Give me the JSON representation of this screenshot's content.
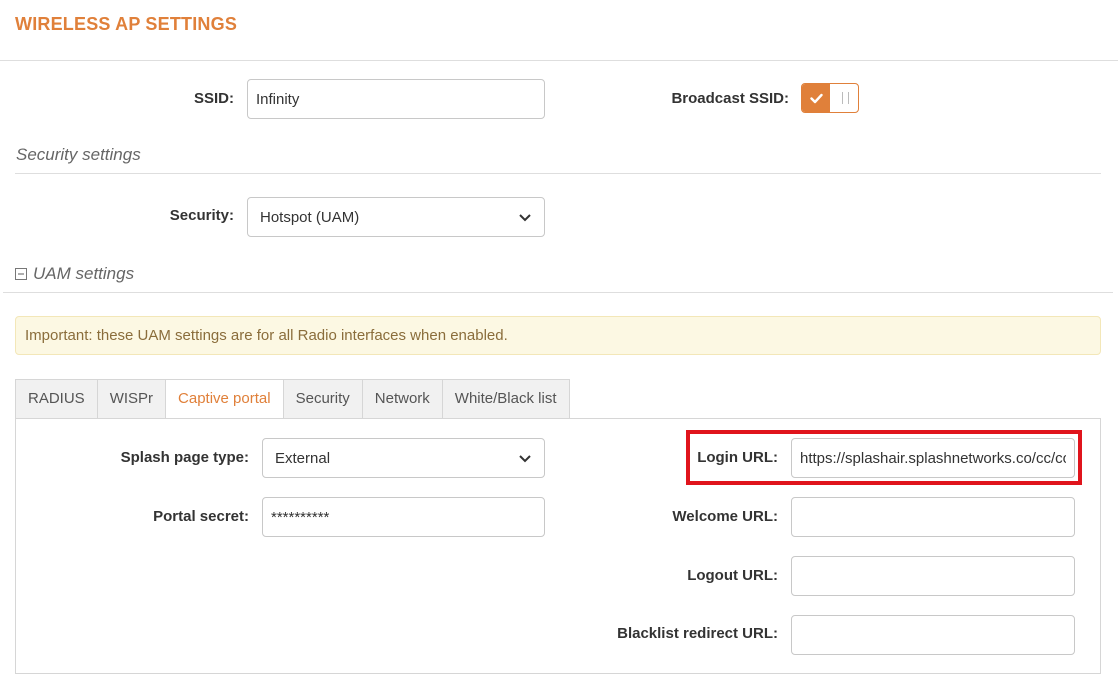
{
  "page": {
    "title": "WIRELESS AP SETTINGS"
  },
  "ssid": {
    "label": "SSID:",
    "value": "Infinity"
  },
  "broadcast": {
    "label": "Broadcast SSID:",
    "enabled": true,
    "icon": "check-icon"
  },
  "security_section": {
    "title": "Security settings"
  },
  "security": {
    "label": "Security:",
    "selected": "Hotspot (UAM)"
  },
  "uam_section": {
    "title": "UAM settings",
    "collapse_icon": "minus-square-icon"
  },
  "alert": {
    "text": "Important: these UAM settings are for all Radio interfaces when enabled."
  },
  "tabs": [
    {
      "label": "RADIUS",
      "active": false
    },
    {
      "label": "WISPr",
      "active": false
    },
    {
      "label": "Captive portal",
      "active": true
    },
    {
      "label": "Security",
      "active": false
    },
    {
      "label": "Network",
      "active": false
    },
    {
      "label": "White/Black list",
      "active": false
    }
  ],
  "captive_portal": {
    "splash_type": {
      "label": "Splash page type:",
      "selected": "External"
    },
    "portal_secret": {
      "label": "Portal secret:",
      "value": "**********"
    },
    "login_url": {
      "label": "Login URL:",
      "value": "https://splashair.splashnetworks.co/cc/co"
    },
    "welcome_url": {
      "label": "Welcome URL:",
      "value": ""
    },
    "logout_url": {
      "label": "Logout URL:",
      "value": ""
    },
    "blacklist_url": {
      "label": "Blacklist redirect URL:",
      "value": ""
    }
  },
  "colors": {
    "accent": "#e0803a",
    "highlight": "#e0141c",
    "alert_bg": "#fcf8e3",
    "alert_text": "#8a6d3b"
  }
}
